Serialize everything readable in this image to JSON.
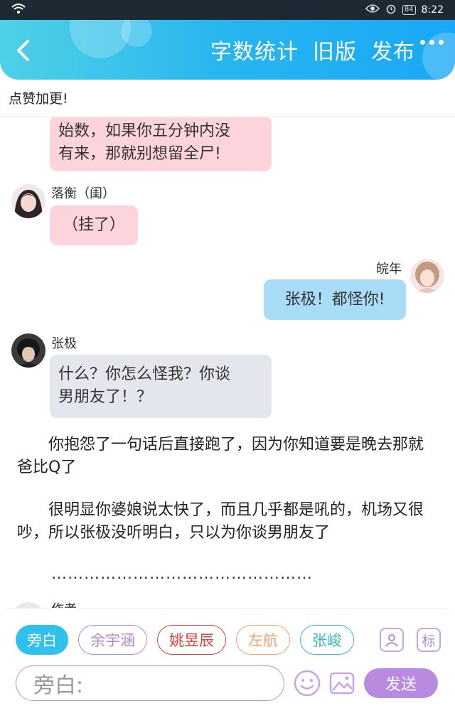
{
  "status_bar": {
    "battery": "84",
    "time": "8:22"
  },
  "header": {
    "actions": [
      "字数统计",
      "旧版",
      "发布"
    ]
  },
  "notice": "点赞加更!",
  "chat": {
    "top_bubble_lines": [
      "始数，如果你五分钟内没",
      "有来，那就别想留全尸!"
    ],
    "msg1": {
      "sender": "落衡（闺）",
      "text": "（挂了）"
    },
    "msg2": {
      "sender": "皖年",
      "text": "张极！都怪你!"
    },
    "msg3": {
      "sender": "张极",
      "lines": [
        "什么？你怎么怪我？你谈",
        "男朋友了！？"
      ]
    },
    "narration1": "你抱怨了一句话后直接跑了，因为你知道要是晚去那就爸比Q了",
    "narration2": "很明显你婆娘说太快了，而且几乎都是吼的，机场又很吵，所以张极没听明白，只以为你谈男朋友了",
    "ellipsis": "…………………………………………",
    "partial_sender": "作者"
  },
  "input_panel": {
    "chips": [
      {
        "label": "旁白",
        "color": "#2fc0ee",
        "filled": true
      },
      {
        "label": "余宇涵",
        "color": "#b784dd",
        "filled": false
      },
      {
        "label": "姚昱辰",
        "color": "#d9403a",
        "filled": false
      },
      {
        "label": "左航",
        "color": "#f2a06e",
        "filled": false
      },
      {
        "label": "张峻",
        "color": "#3bb8c8",
        "filled": false
      }
    ],
    "tag_label": "标",
    "placeholder": "旁白:",
    "send_label": "发送"
  }
}
